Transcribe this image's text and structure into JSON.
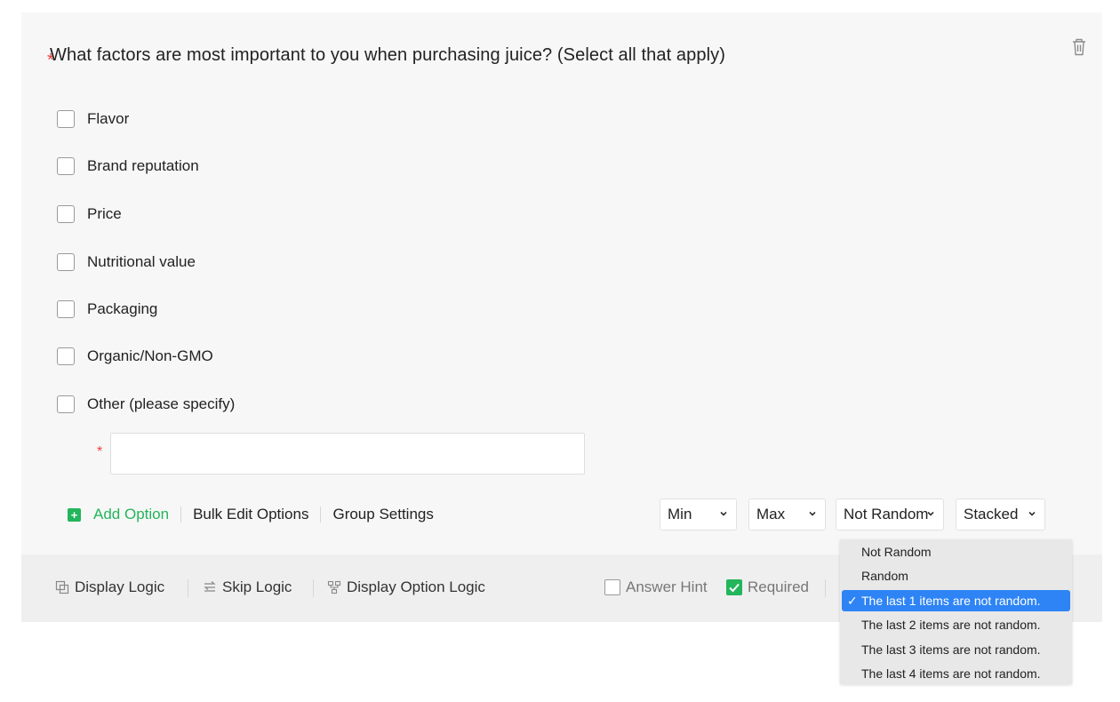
{
  "question": {
    "required_marker": "*",
    "title": "What factors are most important to you when purchasing juice? (Select all that apply)",
    "options": [
      {
        "label": "Flavor",
        "checked": false
      },
      {
        "label": "Brand reputation",
        "checked": false
      },
      {
        "label": "Price",
        "checked": false
      },
      {
        "label": "Nutritional value",
        "checked": false
      },
      {
        "label": "Packaging",
        "checked": false
      },
      {
        "label": "Organic/Non-GMO",
        "checked": false
      },
      {
        "label": "Other (please specify)",
        "checked": false
      }
    ],
    "other_input": {
      "value": "",
      "required_marker": "*"
    }
  },
  "toolbar": {
    "add_option": "Add Option",
    "bulk_edit": "Bulk Edit Options",
    "group_settings": "Group Settings"
  },
  "selects": {
    "min": "Min",
    "max": "Max",
    "random": "Not Random",
    "layout": "Stacked"
  },
  "footer": {
    "display_logic": "Display Logic",
    "skip_logic": "Skip Logic",
    "display_option_logic": "Display Option Logic",
    "answer_hint": {
      "label": "Answer Hint",
      "checked": false
    },
    "required": {
      "label": "Required",
      "checked": true
    }
  },
  "random_dropdown": {
    "items": [
      "Not Random",
      "Random",
      "The last 1 items are not random.",
      "The last 2 items are not random.",
      "The last 3 items are not random.",
      "The last 4 items are not random."
    ],
    "selected_index": 2,
    "check_glyph": "✓"
  },
  "colors": {
    "accent_green": "#23b55b",
    "required_red": "#f23f3f",
    "selection_blue": "#2e84f5"
  }
}
